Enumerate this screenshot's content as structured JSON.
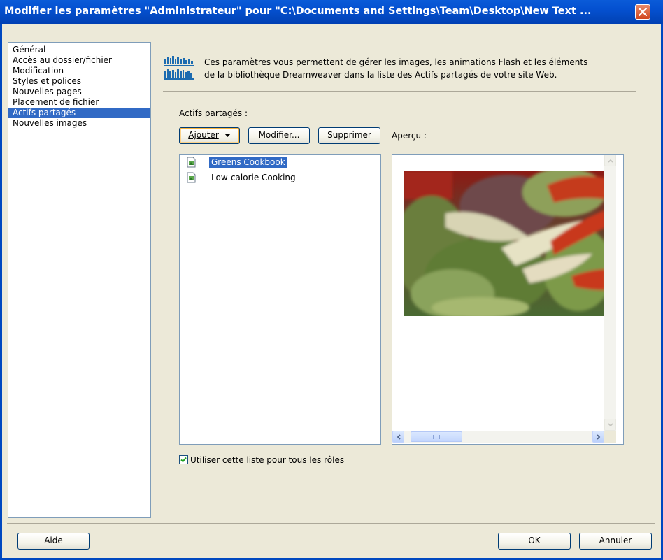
{
  "window": {
    "title": "Modifier les paramètres \"Administrateur\" pour \"C:\\Documents and Settings\\Team\\Desktop\\New Text ..."
  },
  "sidebar": {
    "items": [
      {
        "label": "Général"
      },
      {
        "label": "Accès au dossier/fichier"
      },
      {
        "label": "Modification"
      },
      {
        "label": "Styles et polices"
      },
      {
        "label": "Nouvelles pages"
      },
      {
        "label": "Placement de fichier"
      },
      {
        "label": "Actifs partagés",
        "selected": true
      },
      {
        "label": "Nouvelles images"
      }
    ]
  },
  "info": {
    "line1": "Ces paramètres vous permettent de gérer les images, les animations Flash et les éléments",
    "line2": "de la bibliothèque Dreamweaver dans la liste des Actifs partagés de votre site Web."
  },
  "assets": {
    "label": "Actifs partagés :",
    "add_button": "Ajouter",
    "edit_button": "Modifier...",
    "delete_button": "Supprimer",
    "items": [
      {
        "label": "Greens Cookbook",
        "selected": true
      },
      {
        "label": "Low-calorie Cooking"
      }
    ]
  },
  "preview": {
    "label": "Aperçu :"
  },
  "checkbox": {
    "label": "Utiliser cette liste pour tous les rôles",
    "checked": true
  },
  "footer": {
    "help_button": "Aide",
    "ok_button": "OK",
    "cancel_button": "Annuler"
  },
  "colors": {
    "title_bar": "#0450d0",
    "selection": "#316ac5",
    "dialog_bg": "#ece9d8"
  }
}
